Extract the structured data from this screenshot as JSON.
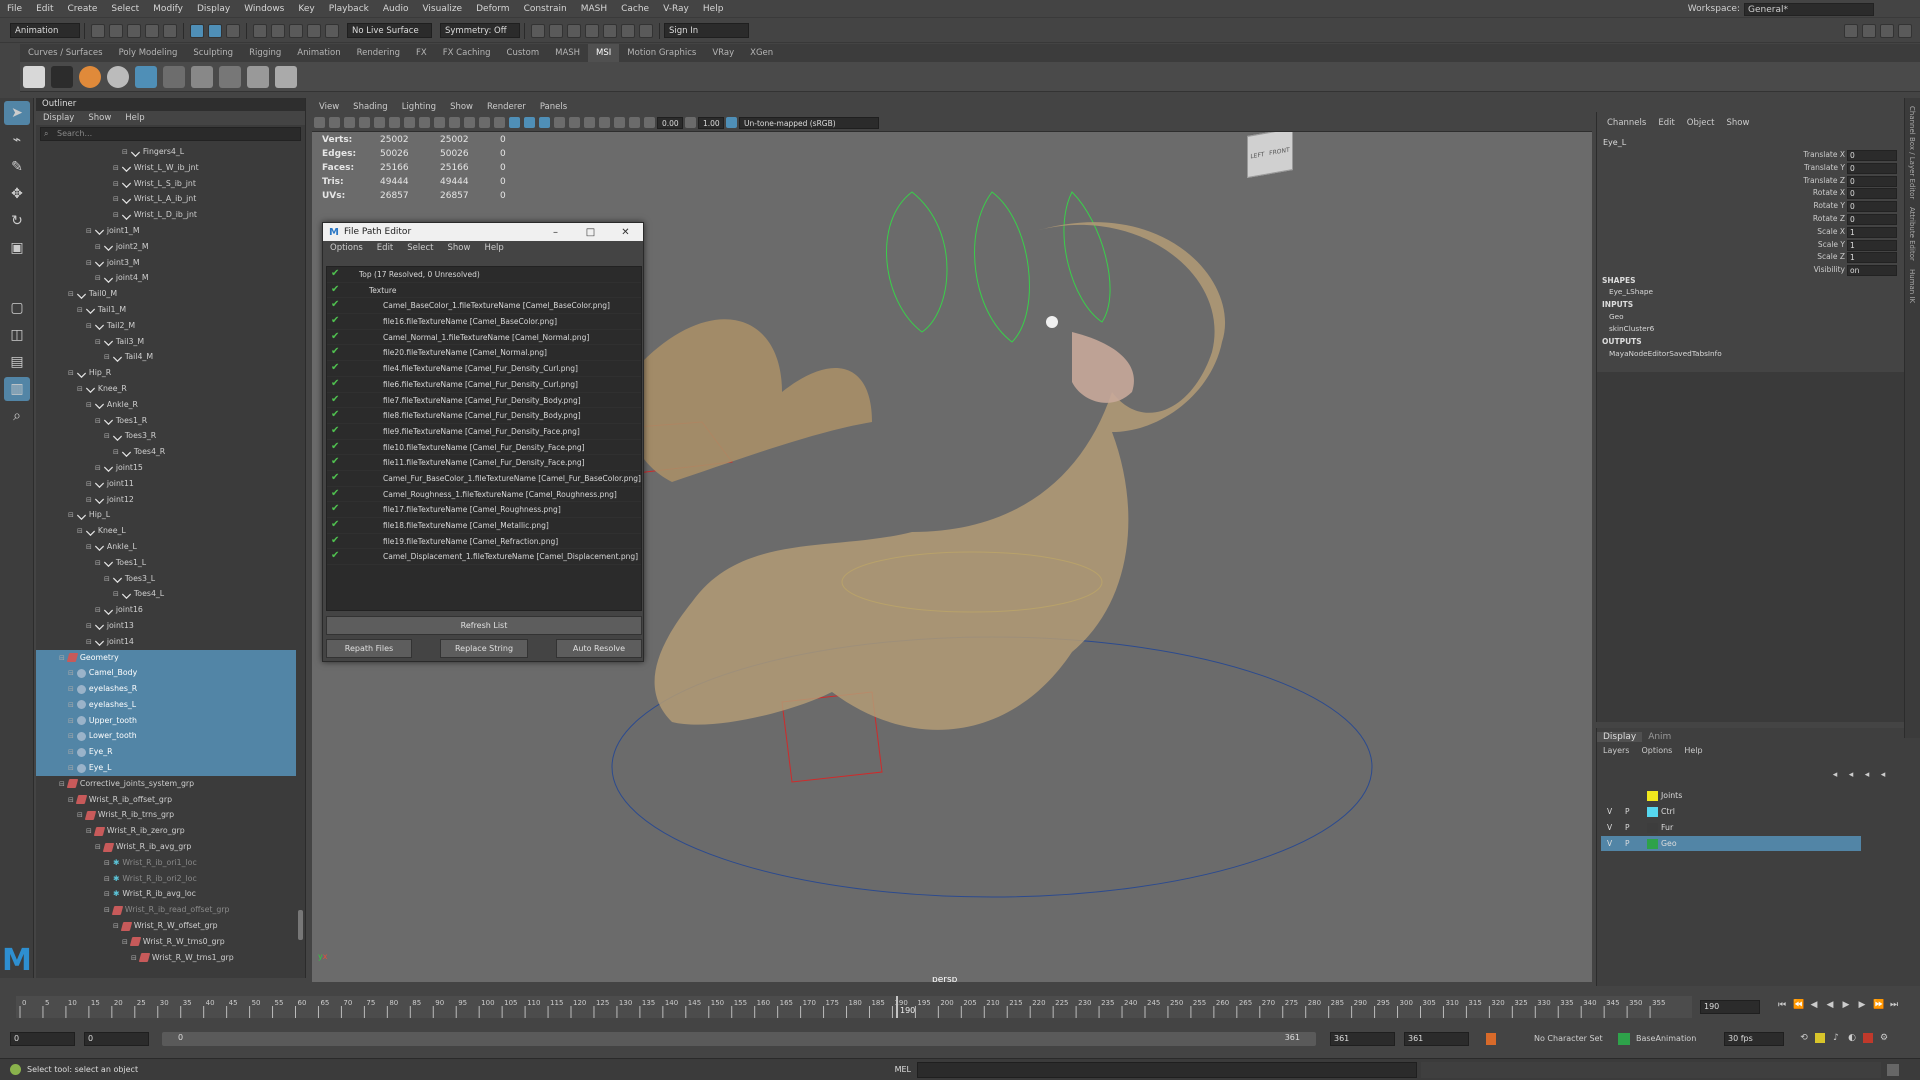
{
  "menubar": {
    "items": [
      "File",
      "Edit",
      "Create",
      "Select",
      "Modify",
      "Display",
      "Windows",
      "Key",
      "Playback",
      "Audio",
      "Visualize",
      "Deform",
      "Constrain",
      "MASH",
      "Cache",
      "V-Ray",
      "Help"
    ],
    "workspace_label": "Workspace:",
    "workspace_value": "General*"
  },
  "statusline": {
    "menuset": "Animation",
    "live_surface": "No Live Surface",
    "symmetry": "Symmetry: Off",
    "sign_in": "Sign In"
  },
  "shelf": {
    "tabs": [
      "Curves / Surfaces",
      "Poly Modeling",
      "Sculpting",
      "Rigging",
      "Animation",
      "Rendering",
      "FX",
      "FX Caching",
      "Custom",
      "MASH",
      "MSI",
      "Motion Graphics",
      "VRay",
      "XGen"
    ],
    "active_tab": "MSI",
    "icons": [
      "CP",
      "",
      "",
      "",
      "",
      "",
      "Dkg",
      "",
      "",
      "Usgr"
    ]
  },
  "outliner": {
    "title": "Outliner",
    "menu": [
      "Display",
      "Show",
      "Help"
    ],
    "search_placeholder": "Search...",
    "items": [
      {
        "label": "Fingers4_L",
        "indent": 8,
        "icon": "jnt"
      },
      {
        "label": "Wrist_L_W_ib_jnt",
        "indent": 7,
        "icon": "jnt"
      },
      {
        "label": "Wrist_L_S_ib_jnt",
        "indent": 7,
        "icon": "jnt"
      },
      {
        "label": "Wrist_L_A_ib_jnt",
        "indent": 7,
        "icon": "jnt"
      },
      {
        "label": "Wrist_L_D_ib_jnt",
        "indent": 7,
        "icon": "jnt"
      },
      {
        "label": "joint1_M",
        "indent": 4,
        "icon": "jnt"
      },
      {
        "label": "joint2_M",
        "indent": 5,
        "icon": "jnt"
      },
      {
        "label": "joint3_M",
        "indent": 4,
        "icon": "jnt"
      },
      {
        "label": "joint4_M",
        "indent": 5,
        "icon": "jnt"
      },
      {
        "label": "Tail0_M",
        "indent": 2,
        "icon": "jnt"
      },
      {
        "label": "Tail1_M",
        "indent": 3,
        "icon": "jnt"
      },
      {
        "label": "Tail2_M",
        "indent": 4,
        "icon": "jnt"
      },
      {
        "label": "Tail3_M",
        "indent": 5,
        "icon": "jnt"
      },
      {
        "label": "Tail4_M",
        "indent": 6,
        "icon": "jnt"
      },
      {
        "label": "Hip_R",
        "indent": 2,
        "icon": "jnt"
      },
      {
        "label": "Knee_R",
        "indent": 3,
        "icon": "jnt"
      },
      {
        "label": "Ankle_R",
        "indent": 4,
        "icon": "jnt"
      },
      {
        "label": "Toes1_R",
        "indent": 5,
        "icon": "jnt"
      },
      {
        "label": "Toes3_R",
        "indent": 6,
        "icon": "jnt"
      },
      {
        "label": "Toes4_R",
        "indent": 7,
        "icon": "jnt"
      },
      {
        "label": "joint15",
        "indent": 5,
        "icon": "jnt"
      },
      {
        "label": "joint11",
        "indent": 4,
        "icon": "jnt"
      },
      {
        "label": "joint12",
        "indent": 4,
        "icon": "jnt"
      },
      {
        "label": "Hip_L",
        "indent": 2,
        "icon": "jnt"
      },
      {
        "label": "Knee_L",
        "indent": 3,
        "icon": "jnt"
      },
      {
        "label": "Ankle_L",
        "indent": 4,
        "icon": "jnt"
      },
      {
        "label": "Toes1_L",
        "indent": 5,
        "icon": "jnt"
      },
      {
        "label": "Toes3_L",
        "indent": 6,
        "icon": "jnt"
      },
      {
        "label": "Toes4_L",
        "indent": 7,
        "icon": "jnt"
      },
      {
        "label": "joint16",
        "indent": 5,
        "icon": "jnt"
      },
      {
        "label": "joint13",
        "indent": 4,
        "icon": "jnt"
      },
      {
        "label": "joint14",
        "indent": 4,
        "icon": "jnt"
      },
      {
        "label": "Geometry",
        "indent": 1,
        "icon": "grp",
        "selected": true
      },
      {
        "label": "Camel_Body",
        "indent": 2,
        "icon": "msh",
        "selected": true
      },
      {
        "label": "eyelashes_R",
        "indent": 2,
        "icon": "msh",
        "selected": true
      },
      {
        "label": "eyelashes_L",
        "indent": 2,
        "icon": "msh",
        "selected": true
      },
      {
        "label": "Upper_tooth",
        "indent": 2,
        "icon": "msh",
        "selected": true
      },
      {
        "label": "Lower_tooth",
        "indent": 2,
        "icon": "msh",
        "selected": true
      },
      {
        "label": "Eye_R",
        "indent": 2,
        "icon": "msh",
        "selected": true
      },
      {
        "label": "Eye_L",
        "indent": 2,
        "icon": "msh",
        "selected": true
      },
      {
        "label": "Corrective_joints_system_grp",
        "indent": 1,
        "icon": "grp"
      },
      {
        "label": "Wrist_R_ib_offset_grp",
        "indent": 2,
        "icon": "grp"
      },
      {
        "label": "Wrist_R_ib_trns_grp",
        "indent": 3,
        "icon": "grp"
      },
      {
        "label": "Wrist_R_ib_zero_grp",
        "indent": 4,
        "icon": "grp"
      },
      {
        "label": "Wrist_R_ib_avg_grp",
        "indent": 5,
        "icon": "grp"
      },
      {
        "label": "Wrist_R_ib_ori1_loc",
        "indent": 6,
        "icon": "loc",
        "dim": true
      },
      {
        "label": "Wrist_R_ib_ori2_loc",
        "indent": 6,
        "icon": "loc",
        "dim": true
      },
      {
        "label": "Wrist_R_ib_avg_loc",
        "indent": 6,
        "icon": "loc"
      },
      {
        "label": "Wrist_R_ib_read_offset_grp",
        "indent": 6,
        "icon": "grp",
        "dim": true
      },
      {
        "label": "Wrist_R_W_offset_grp",
        "indent": 7,
        "icon": "grp"
      },
      {
        "label": "Wrist_R_W_trns0_grp",
        "indent": 8,
        "icon": "grp"
      },
      {
        "label": "Wrist_R_W_trns1_grp",
        "indent": 9,
        "icon": "grp"
      }
    ]
  },
  "panel": {
    "menu": [
      "View",
      "Shading",
      "Lighting",
      "Show",
      "Renderer",
      "Panels"
    ],
    "exposure": "0.00",
    "gamma": "1.00",
    "colorspace": "Un-tone-mapped (sRGB)",
    "camera": "persp",
    "viewcube": [
      "LEFT",
      "FRONT"
    ],
    "hud": [
      {
        "label": "Verts:",
        "a": "25002",
        "b": "25002",
        "c": "0"
      },
      {
        "label": "Edges:",
        "a": "50026",
        "b": "50026",
        "c": "0"
      },
      {
        "label": "Faces:",
        "a": "25166",
        "b": "25166",
        "c": "0"
      },
      {
        "label": "Tris:",
        "a": "49444",
        "b": "49444",
        "c": "0"
      },
      {
        "label": "UVs:",
        "a": "26857",
        "b": "26857",
        "c": "0"
      }
    ]
  },
  "file_path_editor": {
    "title": "File Path Editor",
    "menu": [
      "Options",
      "Edit",
      "Select",
      "Show",
      "Help"
    ],
    "top_label": "Top (17 Resolved, 0 Unresolved)",
    "texture_label": "Texture",
    "files": [
      "Camel_BaseColor_1.fileTextureName [Camel_BaseColor.png]",
      "file16.fileTextureName [Camel_BaseColor.png]",
      "Camel_Normal_1.fileTextureName [Camel_Normal.png]",
      "file20.fileTextureName [Camel_Normal.png]",
      "file4.fileTextureName [Camel_Fur_Density_Curl.png]",
      "file6.fileTextureName [Camel_Fur_Density_Curl.png]",
      "file7.fileTextureName [Camel_Fur_Density_Body.png]",
      "file8.fileTextureName [Camel_Fur_Density_Body.png]",
      "file9.fileTextureName [Camel_Fur_Density_Face.png]",
      "file10.fileTextureName [Camel_Fur_Density_Face.png]",
      "file11.fileTextureName [Camel_Fur_Density_Face.png]",
      "Camel_Fur_BaseColor_1.fileTextureName [Camel_Fur_BaseColor.png]",
      "Camel_Roughness_1.fileTextureName [Camel_Roughness.png]",
      "file17.fileTextureName [Camel_Roughness.png]",
      "file18.fileTextureName [Camel_Metallic.png]",
      "file19.fileTextureName [Camel_Refraction.png]",
      "Camel_Displacement_1.fileTextureName [Camel_Displacement.png]"
    ],
    "refresh_label": "Refresh List",
    "repath_label": "Repath Files",
    "replace_label": "Replace String",
    "auto_label": "Auto Resolve"
  },
  "channel_box": {
    "menu": [
      "Channels",
      "Edit",
      "Object",
      "Show"
    ],
    "object": "Eye_L",
    "attrs": [
      {
        "label": "Translate X",
        "value": "0"
      },
      {
        "label": "Translate Y",
        "value": "0"
      },
      {
        "label": "Translate Z",
        "value": "0"
      },
      {
        "label": "Rotate X",
        "value": "0"
      },
      {
        "label": "Rotate Y",
        "value": "0"
      },
      {
        "label": "Rotate Z",
        "value": "0"
      },
      {
        "label": "Scale X",
        "value": "1"
      },
      {
        "label": "Scale Y",
        "value": "1"
      },
      {
        "label": "Scale Z",
        "value": "1"
      },
      {
        "label": "Visibility",
        "value": "on"
      }
    ],
    "shapes_label": "SHAPES",
    "shape": "Eye_LShape",
    "inputs_label": "INPUTS",
    "inputs": [
      "Geo",
      "skinCluster6"
    ],
    "outputs_label": "OUTPUTS",
    "outputs": [
      "MayaNodeEditorSavedTabsInfo"
    ]
  },
  "layers": {
    "tabs": [
      "Display",
      "Anim"
    ],
    "menu": [
      "Layers",
      "Options",
      "Help"
    ],
    "rows": [
      {
        "v": "",
        "p": "",
        "name": "Joints",
        "color": "#f1e81e"
      },
      {
        "v": "V",
        "p": "P",
        "name": "Ctrl",
        "color": "#56d8f0"
      },
      {
        "v": "V",
        "p": "P",
        "name": "Fur",
        "color": "#3d3d3d"
      },
      {
        "v": "V",
        "p": "P",
        "name": "Geo",
        "color": "#2ea24a",
        "selected": true
      }
    ]
  },
  "sidebar": {
    "labels": [
      "Channel Box / Layer Editor",
      "Attribute Editor",
      "Human IK"
    ]
  },
  "timeline": {
    "ticks": [
      "0",
      "5",
      "10",
      "15",
      "20",
      "25",
      "30",
      "35",
      "40",
      "45",
      "50",
      "55",
      "60",
      "65",
      "70",
      "75",
      "80",
      "85",
      "90",
      "95",
      "100",
      "105",
      "110",
      "115",
      "120",
      "125",
      "130",
      "135",
      "140",
      "145",
      "150",
      "155",
      "160",
      "165",
      "170",
      "175",
      "180",
      "185",
      "190",
      "195",
      "200",
      "205",
      "210",
      "215",
      "220",
      "225",
      "230",
      "235",
      "240",
      "245",
      "250",
      "255",
      "260",
      "265",
      "270",
      "275",
      "280",
      "285",
      "290",
      "295",
      "300",
      "305",
      "310",
      "315",
      "320",
      "325",
      "330",
      "335",
      "340",
      "345",
      "350",
      "355"
    ],
    "current_frame_label": "190",
    "current_frame_field": "190",
    "range_start": "0",
    "range_inner_start": "0",
    "range_slider_start": "0",
    "range_slider_end": "361",
    "range_inner_end": "361",
    "range_end": "361",
    "character_set": "No Character Set",
    "anim_layer": "BaseAnimation",
    "fps": "30 fps"
  },
  "cmdline": {
    "help": "Select tool: select an object",
    "lang": "MEL"
  }
}
